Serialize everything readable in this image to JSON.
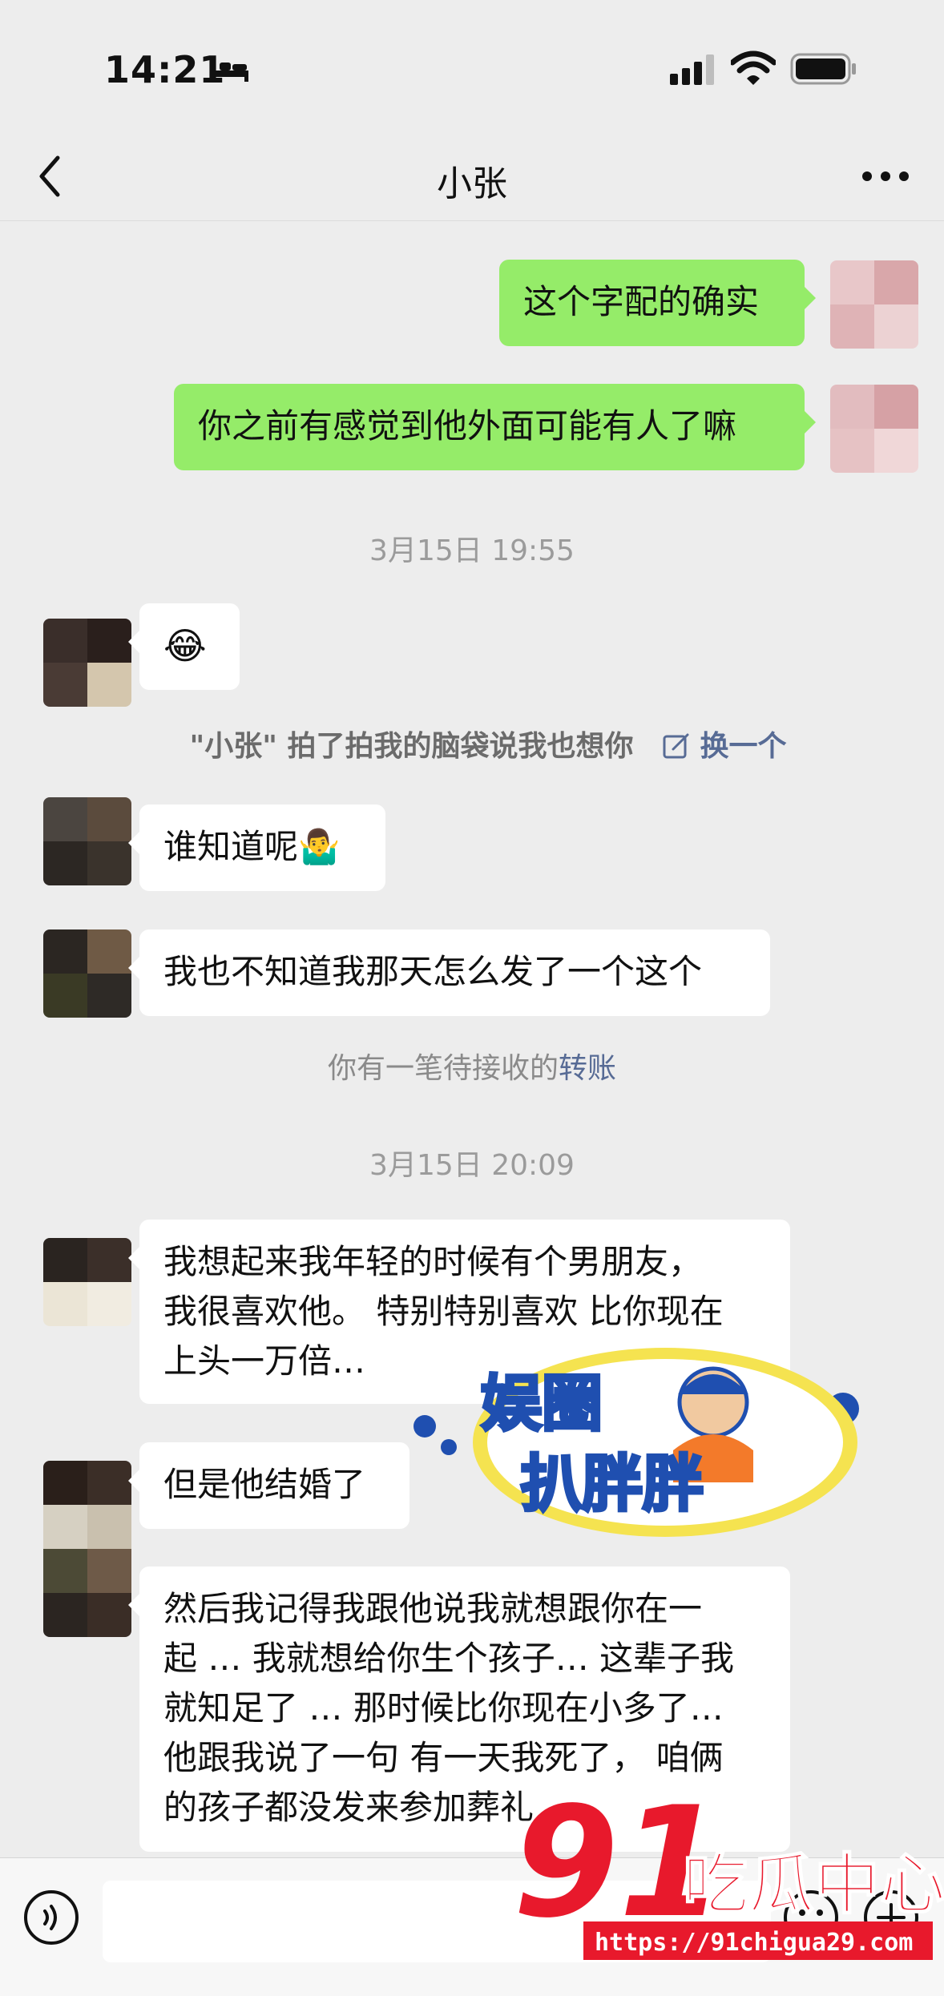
{
  "status": {
    "time": "14:21"
  },
  "chat": {
    "title": "小张"
  },
  "messages": {
    "m1": "这个字配的确实",
    "m2": "你之前有感觉到他外面可能有人了嘛",
    "ts1": "3月15日 19:55",
    "m3_emoji": "😂",
    "pat": "\"小张\" 拍了拍我的脑袋说我也想你",
    "pat_link": "换一个",
    "m4": "谁知道呢🤷‍♂️",
    "m5": "我也不知道我那天怎么发了一个这个",
    "transfer_prefix": "你有一笔待接收的",
    "transfer_link": "转账",
    "ts2": "3月15日 20:09",
    "m6": "我想起来我年轻的时候有个男朋友，\n我很喜欢他。 特别特别喜欢 比你现在\n上头一万倍…",
    "m7": "但是他结婚了",
    "m8": "然后我记得我跟他说我就想跟你在一\n起 … 我就想给你生个孩子… 这辈子我\n就知足了 … 那时候比你现在小多了…\n他跟我说了一句 有一天我死了， 咱俩\n的孩子都没发来参加葬礼"
  },
  "watermarks": {
    "wm1_line1": "娱圈",
    "wm1_line2": "扒胖胖",
    "wm2_logo": "91",
    "wm2_text": "吃瓜中心",
    "wm2_url": "https://91chigua29.com"
  },
  "colors": {
    "me_bubble": "#95ec69",
    "other_bubble": "#ffffff",
    "link": "#576b95",
    "bg": "#ededed"
  }
}
